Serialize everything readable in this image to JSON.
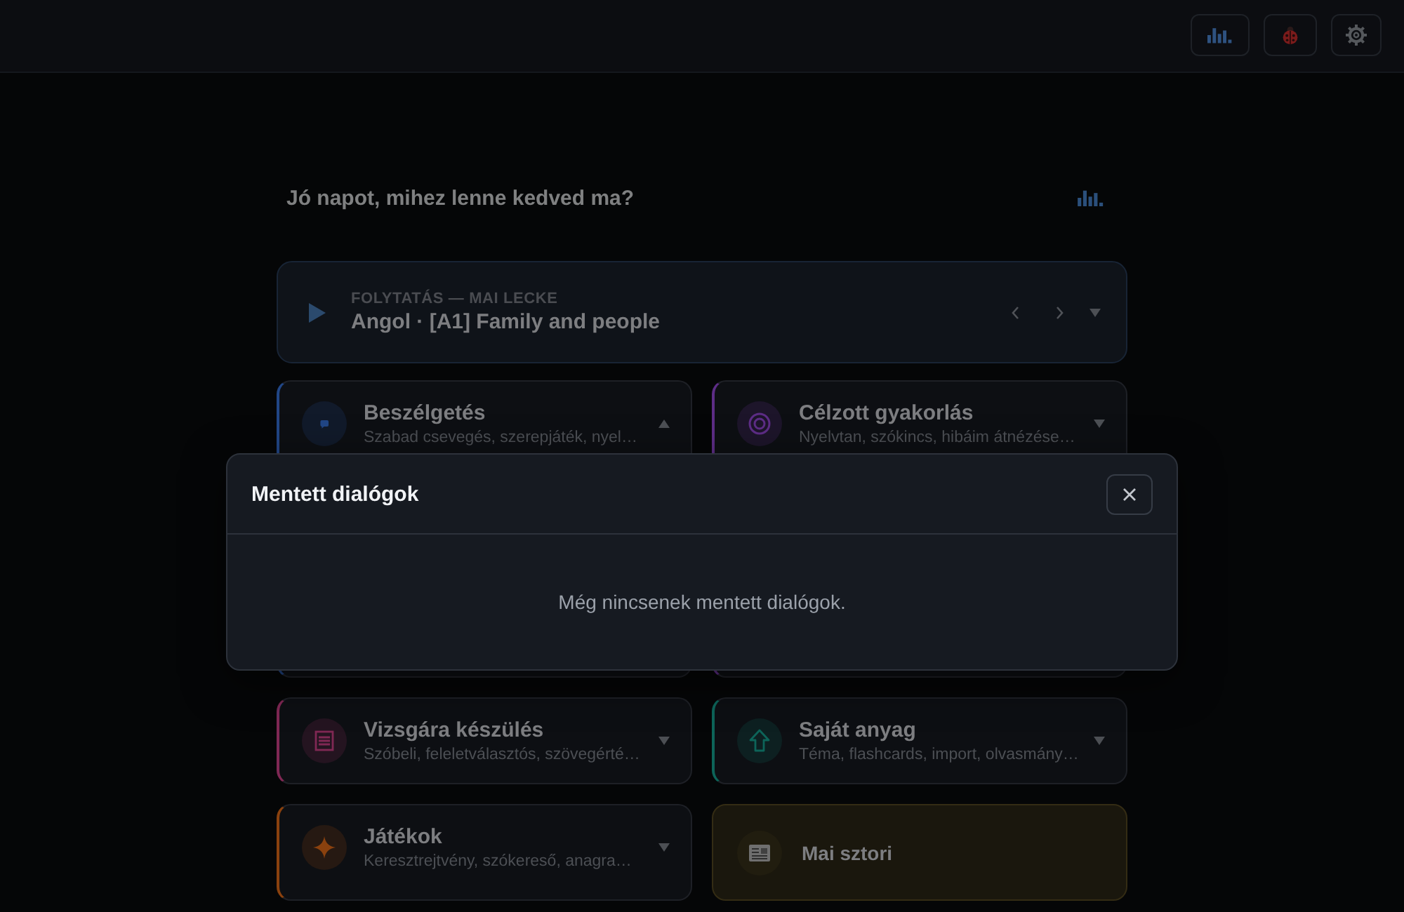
{
  "greeting": "Jó napot, mihez lenne kedved ma?",
  "continue_card": {
    "label": "FOLYTATÁS — MAI LECKE",
    "title": "Angol · [A1] Family and people"
  },
  "sections": [
    {
      "kind": "section",
      "title": "Beszélgetés",
      "subtitle": "Szabad csevegés, szerepjáték, nyel…",
      "color": "#111a2a",
      "expanded": true
    },
    {
      "kind": "section",
      "title": "Célzott gyakorlás",
      "subtitle": "Nyelvtan, szókincs, hibáim átnézése…",
      "color": "#1d152a",
      "expanded": false
    },
    {
      "kind": "section",
      "title": "Vizsgára készülés",
      "subtitle": "Szóbeli, feleletválasztós, szövegérté…",
      "color": "#241420",
      "expanded": false
    },
    {
      "kind": "section",
      "title": "Saját anyag",
      "subtitle": "Téma, flashcards, import, olvasmány…",
      "color": "#0d2021",
      "expanded": false
    },
    {
      "kind": "section",
      "title": "Játékok",
      "subtitle": "Keresztrejtvény, szókereső, anagra…",
      "color": "#261912",
      "expanded": false
    },
    {
      "kind": "highlight",
      "title": "Mai sztori",
      "color": "#342c14"
    }
  ],
  "modal": {
    "title": "Mentett dialógok",
    "empty_text": "Még nincsenek mentett dialógok."
  }
}
